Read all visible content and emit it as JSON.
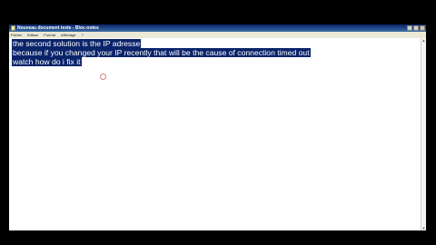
{
  "window": {
    "title": "Nouveau document texte - Bloc-notes"
  },
  "menubar": {
    "items": [
      {
        "label": "Fichier"
      },
      {
        "label": "Edition"
      },
      {
        "label": "Format"
      },
      {
        "label": "Affichage"
      },
      {
        "label": "?"
      }
    ]
  },
  "editor": {
    "lines": [
      "the second solution is the IP adresse",
      "because if you changed your IP recently that will be the cause of connection timed out",
      "watch how do i fix it"
    ],
    "selection_color": "#0a246a",
    "selected_text_color": "#ffffff"
  },
  "icons": {
    "app": "notepad-icon",
    "cursor": "mouse-cursor-ring-icon"
  }
}
